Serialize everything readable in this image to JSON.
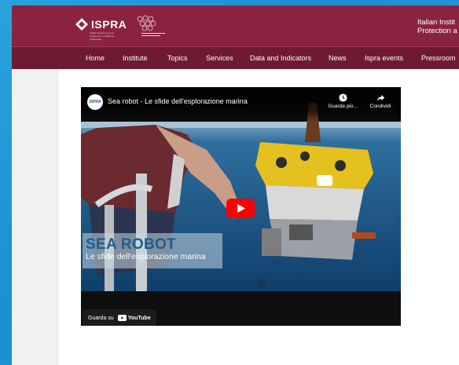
{
  "header": {
    "logo_text": "ISPRA",
    "logo_subtitle": "Istituto Superiore per la Protezione e la Ricerca Ambientale",
    "right_text_line1": "Italian Instit",
    "right_text_line2": "Protection a"
  },
  "nav": {
    "items": [
      {
        "label": "Home"
      },
      {
        "label": "Institute"
      },
      {
        "label": "Topics"
      },
      {
        "label": "Services"
      },
      {
        "label": "Data and Indicators"
      },
      {
        "label": "News"
      },
      {
        "label": "Ispra events"
      },
      {
        "label": "Pressroom"
      }
    ]
  },
  "video": {
    "channel_avatar": "ISPRA",
    "title": "Sea robot - Le sfide dell'esplorazione marina",
    "watch_later_label": "Guarda più...",
    "share_label": "Condividi",
    "overlay_title": "SEA ROBOT",
    "overlay_subtitle": "Le sfide dell'esplorazione marina",
    "watch_on_label": "Guarda su",
    "youtube_word": "YouTube"
  },
  "colors": {
    "header_bg": "#8a2341",
    "nav_bg": "#6f1a33",
    "desktop_bg": "#1b8fd0",
    "play_red": "#ff0000"
  }
}
